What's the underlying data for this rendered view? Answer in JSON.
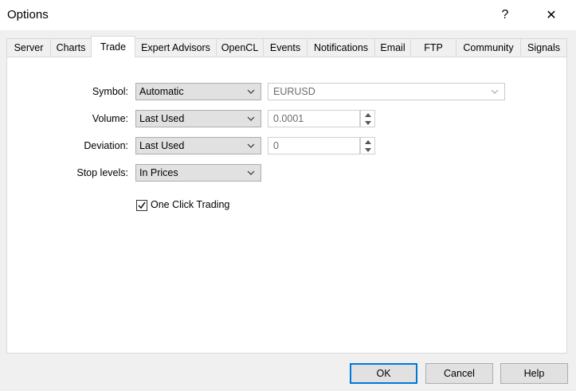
{
  "window": {
    "title": "Options",
    "help_symbol": "?",
    "close_symbol": "✕"
  },
  "tabs": [
    {
      "label": "Server"
    },
    {
      "label": "Charts"
    },
    {
      "label": "Trade"
    },
    {
      "label": "Expert Advisors"
    },
    {
      "label": "OpenCL"
    },
    {
      "label": "Events"
    },
    {
      "label": "Notifications"
    },
    {
      "label": "Email"
    },
    {
      "label": "FTP"
    },
    {
      "label": "Community"
    },
    {
      "label": "Signals"
    }
  ],
  "active_tab": "Trade",
  "form": {
    "symbol": {
      "label": "Symbol:",
      "mode": "Automatic",
      "value": "EURUSD"
    },
    "volume": {
      "label": "Volume:",
      "mode": "Last Used",
      "value": "0.0001"
    },
    "deviation": {
      "label": "Deviation:",
      "mode": "Last Used",
      "value": "0"
    },
    "stop_levels": {
      "label": "Stop levels:",
      "mode": "In Prices"
    },
    "one_click": {
      "label": "One Click Trading",
      "checked": true
    }
  },
  "buttons": {
    "ok": "OK",
    "cancel": "Cancel",
    "help": "Help"
  },
  "icons": {
    "chevron": "chevron-down-icon",
    "spin_up": "arrow-up-icon",
    "spin_down": "arrow-down-icon",
    "check": "checkmark-icon"
  },
  "colors": {
    "default_button_border": "#0078d7",
    "panel_bg": "#ffffff",
    "dialog_bg": "#f0f0f0"
  }
}
